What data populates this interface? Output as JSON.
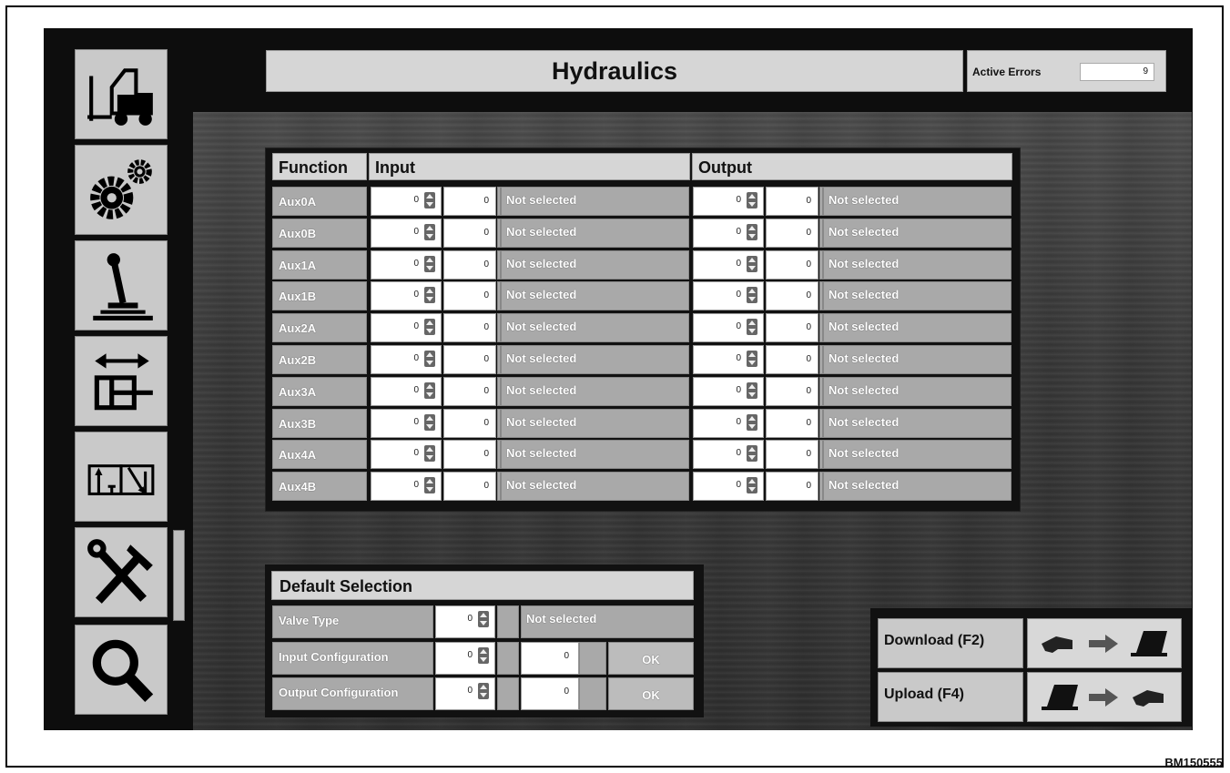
{
  "header": {
    "title": "Hydraulics",
    "active_errors_label": "Active Errors",
    "active_errors_value": "9"
  },
  "sidebar": {
    "items": [
      {
        "icon": "forklift-icon"
      },
      {
        "icon": "gears-icon"
      },
      {
        "icon": "joystick-icon"
      },
      {
        "icon": "cylinder-icon"
      },
      {
        "icon": "valve-icon"
      },
      {
        "icon": "tools-icon"
      },
      {
        "icon": "search-icon"
      }
    ]
  },
  "table": {
    "headers": {
      "function": "Function",
      "input": "Input",
      "output": "Output"
    },
    "rows": [
      {
        "function": "Aux0A",
        "in_spin": "0",
        "in_num": "0",
        "in_status": "Not selected",
        "out_spin": "0",
        "out_num": "0",
        "out_status": "Not selected"
      },
      {
        "function": "Aux0B",
        "in_spin": "0",
        "in_num": "0",
        "in_status": "Not selected",
        "out_spin": "0",
        "out_num": "0",
        "out_status": "Not selected"
      },
      {
        "function": "Aux1A",
        "in_spin": "0",
        "in_num": "0",
        "in_status": "Not selected",
        "out_spin": "0",
        "out_num": "0",
        "out_status": "Not selected"
      },
      {
        "function": "Aux1B",
        "in_spin": "0",
        "in_num": "0",
        "in_status": "Not selected",
        "out_spin": "0",
        "out_num": "0",
        "out_status": "Not selected"
      },
      {
        "function": "Aux2A",
        "in_spin": "0",
        "in_num": "0",
        "in_status": "Not selected",
        "out_spin": "0",
        "out_num": "0",
        "out_status": "Not selected"
      },
      {
        "function": "Aux2B",
        "in_spin": "0",
        "in_num": "0",
        "in_status": "Not selected",
        "out_spin": "0",
        "out_num": "0",
        "out_status": "Not selected"
      },
      {
        "function": "Aux3A",
        "in_spin": "0",
        "in_num": "0",
        "in_status": "Not selected",
        "out_spin": "0",
        "out_num": "0",
        "out_status": "Not selected"
      },
      {
        "function": "Aux3B",
        "in_spin": "0",
        "in_num": "0",
        "in_status": "Not selected",
        "out_spin": "0",
        "out_num": "0",
        "out_status": "Not selected"
      },
      {
        "function": "Aux4A",
        "in_spin": "0",
        "in_num": "0",
        "in_status": "Not selected",
        "out_spin": "0",
        "out_num": "0",
        "out_status": "Not selected"
      },
      {
        "function": "Aux4B",
        "in_spin": "0",
        "in_num": "0",
        "in_status": "Not selected",
        "out_spin": "0",
        "out_num": "0",
        "out_status": "Not selected"
      }
    ]
  },
  "default_selection": {
    "title": "Default Selection",
    "rows": [
      {
        "label": "Valve Type",
        "spin": "0",
        "value": "Not selected"
      },
      {
        "label": "Input Configuration",
        "spin": "0",
        "value": "0",
        "ok": "OK"
      },
      {
        "label": "Output Configuration",
        "spin": "0",
        "value": "0",
        "ok": "OK"
      }
    ]
  },
  "transfer": {
    "download_label": "Download (F2)",
    "upload_label": "Upload (F4)"
  },
  "figure_code": "BM150555"
}
